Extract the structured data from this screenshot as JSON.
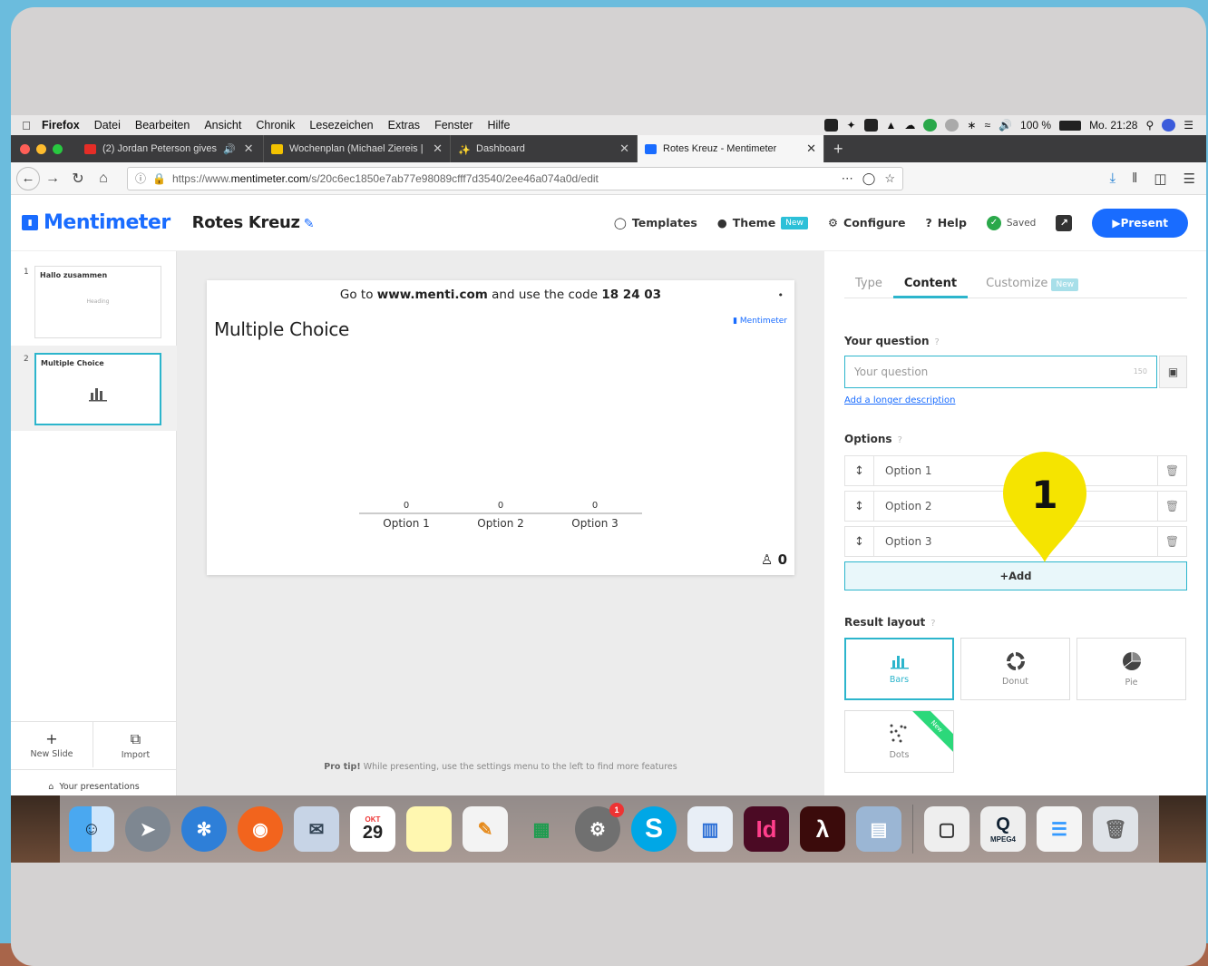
{
  "menubar": {
    "items": [
      "Firefox",
      "Datei",
      "Bearbeiten",
      "Ansicht",
      "Chronik",
      "Lesezeichen",
      "Extras",
      "Fenster",
      "Hilfe"
    ],
    "battery": "100 %",
    "clock": "Mo. 21:28"
  },
  "tabs": [
    {
      "title": "(2) Jordan Peterson gives",
      "favicon_color": "#e52d27",
      "active": false
    },
    {
      "title": "Wochenplan (Michael Ziereis |",
      "favicon_color": "#f2c200",
      "active": false
    },
    {
      "title": "Dashboard",
      "favicon_color": "#e0533c",
      "active": false
    },
    {
      "title": "Rotes Kreuz - Mentimeter",
      "favicon_color": "#196cff",
      "active": true
    }
  ],
  "address": {
    "prefix": "https://www.",
    "domain": "mentimeter.com",
    "path": "/s/20c6ec1850e7ab77e98089cfff7d3540/2ee46a074a0d/edit"
  },
  "app": {
    "logo": "Mentimeter",
    "presentation_title": "Rotes Kreuz",
    "nav": {
      "templates": "Templates",
      "theme": "Theme",
      "theme_badge": "New",
      "configure": "Configure",
      "help": "Help",
      "saved": "Saved",
      "present": "Present"
    }
  },
  "sidebar": {
    "slides": [
      {
        "num": "1",
        "title": "Hallo zusammen",
        "sub": "Heading"
      },
      {
        "num": "2",
        "title": "Multiple Choice",
        "sub": ""
      }
    ],
    "new_slide": "New Slide",
    "import": "Import",
    "your_presentations": "Your presentations"
  },
  "slide": {
    "code_prefix": "Go to ",
    "code_site": "www.menti.com",
    "code_middle": " and use the code ",
    "code": "18 24 03",
    "title": "Multiple Choice",
    "brand": "Mentimeter",
    "votes": "0"
  },
  "chart_data": {
    "type": "bar",
    "categories": [
      "Option 1",
      "Option 2",
      "Option 3"
    ],
    "values": [
      0,
      0,
      0
    ],
    "title": "Multiple Choice"
  },
  "protip": {
    "label": "Pro tip!",
    "text": " While presenting, use the settings menu to the left to find more features"
  },
  "panel": {
    "tabs": [
      "Type",
      "Content",
      "Customize"
    ],
    "customize_badge": "New",
    "question_label": "Your question",
    "question_placeholder": "Your question",
    "question_counter": "150",
    "add_description": "Add a longer description",
    "options_label": "Options",
    "options": [
      "Option 1",
      "Option 2",
      "Option 3"
    ],
    "add_button": "Add",
    "result_layout_label": "Result layout",
    "layouts": [
      "Bars",
      "Donut",
      "Pie",
      "Dots"
    ],
    "dots_badge": "New"
  },
  "annotation": {
    "number": "1",
    "color": "#f5e400"
  },
  "dock": {
    "calendar_month": "OKT",
    "calendar_day": "29",
    "settings_badge": "1",
    "mpeg_label": "MPEG4"
  }
}
